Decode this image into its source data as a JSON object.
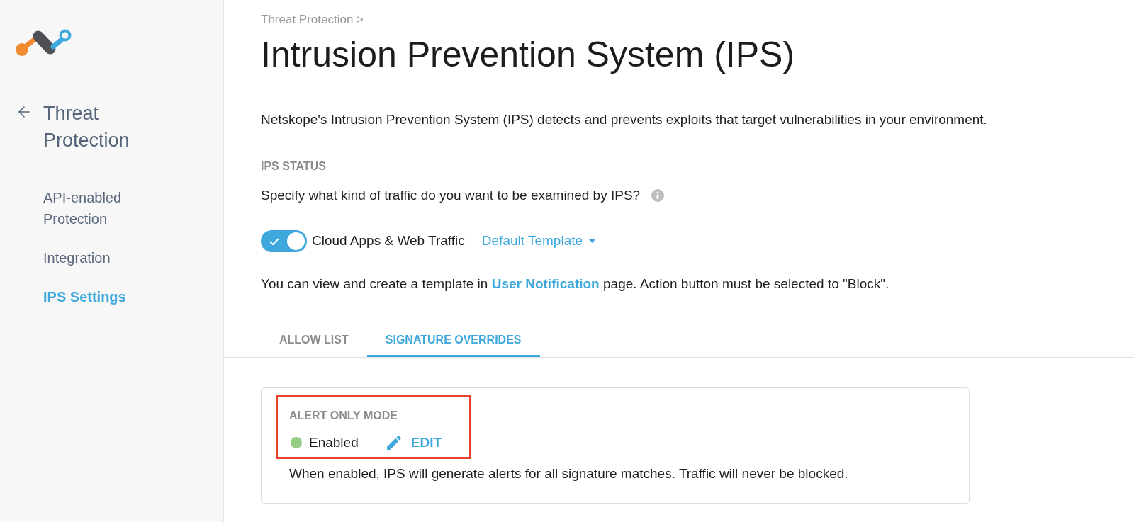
{
  "sidebar": {
    "title": "Threat Protection",
    "items": [
      {
        "label": "API-enabled Protection",
        "selected": false
      },
      {
        "label": "Integration",
        "selected": false
      },
      {
        "label": "IPS Settings",
        "selected": true
      }
    ]
  },
  "header": {
    "breadcrumb": "Threat Protection >",
    "title": "Intrusion Prevention System (IPS)"
  },
  "intro": "Netskope's Intrusion Prevention System (IPS) detects and prevents exploits that target vulnerabilities in your environment.",
  "ips_status": {
    "heading": "IPS STATUS",
    "question": "Specify what kind of traffic do you want to be examined by IPS?",
    "toggle": {
      "label": "Cloud Apps & Web Traffic",
      "on": true
    },
    "template": "Default Template",
    "note": {
      "before": "You can view and create a template in",
      "link": "User Notification",
      "after": "page. Action button must be selected to \"Block\"."
    }
  },
  "tabs": [
    {
      "label": "ALLOW LIST",
      "selected": false
    },
    {
      "label": "SIGNATURE OVERRIDES",
      "selected": true
    }
  ],
  "alert_only_mode": {
    "heading": "ALERT ONLY MODE",
    "highlighted": true,
    "status": {
      "label": "Enabled",
      "color": "#94cc84"
    },
    "edit_label": "EDIT",
    "description": "When enabled, IPS will generate alerts for all signature matches. Traffic will never be blocked."
  }
}
